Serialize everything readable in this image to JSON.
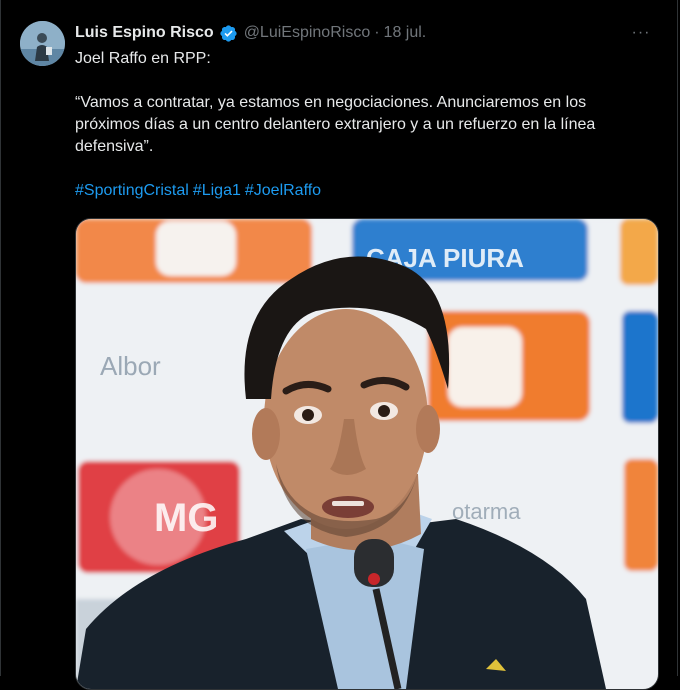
{
  "tweet": {
    "author_name": "Luis Espino Risco",
    "handle": "@LuiEspinoRisco",
    "separator": "·",
    "date": "18 jul.",
    "more_label": "···",
    "line1": "Joel Raffo en RPP:",
    "quote": "“Vamos a contratar, ya estamos en negociaciones. Anunciaremos en los próximos días a un centro delantero extranjero y a un refuerzo en la línea defensiva”.",
    "hashtags": [
      "#SportingCristal",
      "#Liga1",
      "#JoelRaffo"
    ]
  },
  "media": {
    "backdrop_texts": [
      "CAJA PIURA",
      "Albor",
      "MG",
      "otarma"
    ]
  },
  "colors": {
    "background": "#000000",
    "text": "#e7e9ea",
    "muted": "#71767b",
    "link": "#1d9bf0",
    "verified": "#1d9bf0"
  },
  "icons": [
    "verified-badge-icon",
    "more-options-icon",
    "avatar"
  ]
}
